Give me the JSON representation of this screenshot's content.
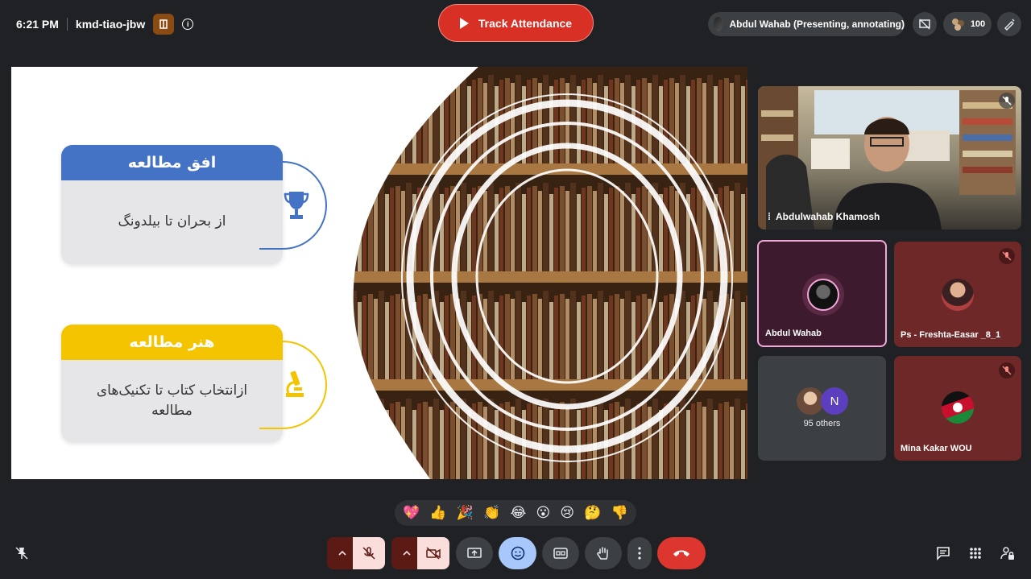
{
  "topbar": {
    "time": "6:21 PM",
    "meeting_code": "kmd-tiao-jbw",
    "track_attendance_label": "Track Attendance",
    "presenting_label": "Abdul Wahab (Presenting, annotating)",
    "participant_count": "100"
  },
  "slide": {
    "card1": {
      "title": "افق مطالعه",
      "body": "از بحران تا بیلدونگ",
      "color": "#4472c4",
      "icon": "trophy-icon"
    },
    "card2": {
      "title": "هنر مطالعه",
      "body": "ازانتخاب کتاب تا تکنیک‌های مطالعه",
      "color": "#f5c400",
      "icon": "microscope-icon"
    }
  },
  "tiles": {
    "main_speaker": "Abdulwahab Khamosh",
    "self": "Abdul Wahab",
    "freshta": "Ps - Freshta-Easar _8_1",
    "others_count": "95 others",
    "others_initial": "N",
    "mina": "Mina Kakar WOU"
  },
  "reactions": [
    "💖",
    "👍",
    "🎉",
    "👏",
    "😂",
    "😮",
    "😢",
    "🤔",
    "👎"
  ],
  "colors": {
    "accent_red": "#d93025",
    "tile_maroon": "#6e2828",
    "self_tile": "#3e1a2f",
    "meet_bg": "#202124"
  }
}
